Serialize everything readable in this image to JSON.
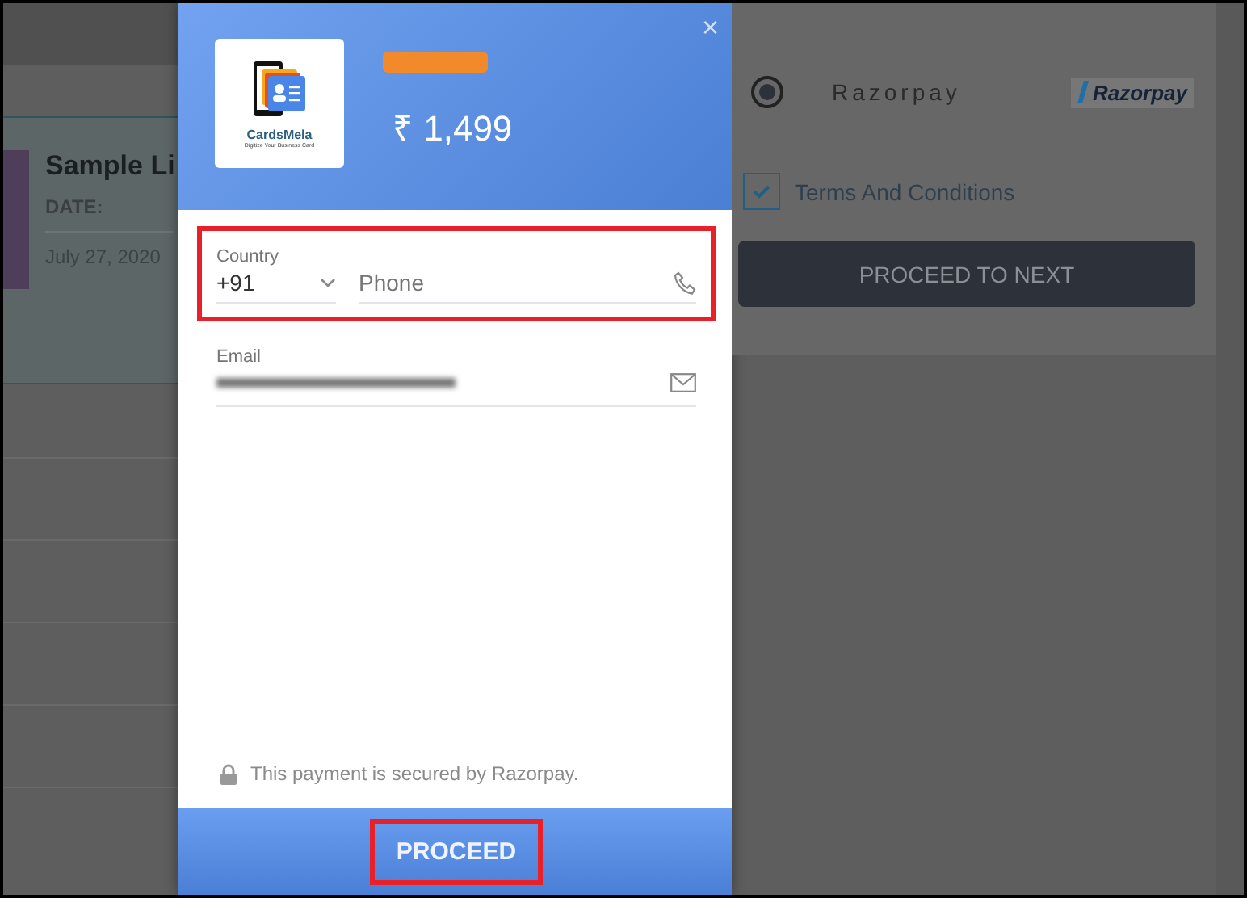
{
  "background": {
    "card": {
      "title": "Sample Li",
      "date_label": "DATE:",
      "date": "July 27, 2020"
    },
    "payment_option": {
      "label": "Razorpay",
      "logo_text": "Razorpay",
      "selected": true
    },
    "terms": {
      "label": "Terms And Conditions",
      "checked": true
    },
    "next_button": "PROCEED TO NEXT"
  },
  "modal": {
    "close": "×",
    "logo": {
      "brand": "CardsMela",
      "tagline": "Digitize Your Business Card"
    },
    "amount": "₹ 1,499",
    "contact": {
      "highlighted": true,
      "country": {
        "label": "Country",
        "value": "+91"
      },
      "phone": {
        "placeholder": "Phone"
      }
    },
    "email": {
      "label": "Email"
    },
    "secure_note": "This payment is secured by Razorpay.",
    "proceed": {
      "label": "PROCEED",
      "highlighted": true
    }
  }
}
